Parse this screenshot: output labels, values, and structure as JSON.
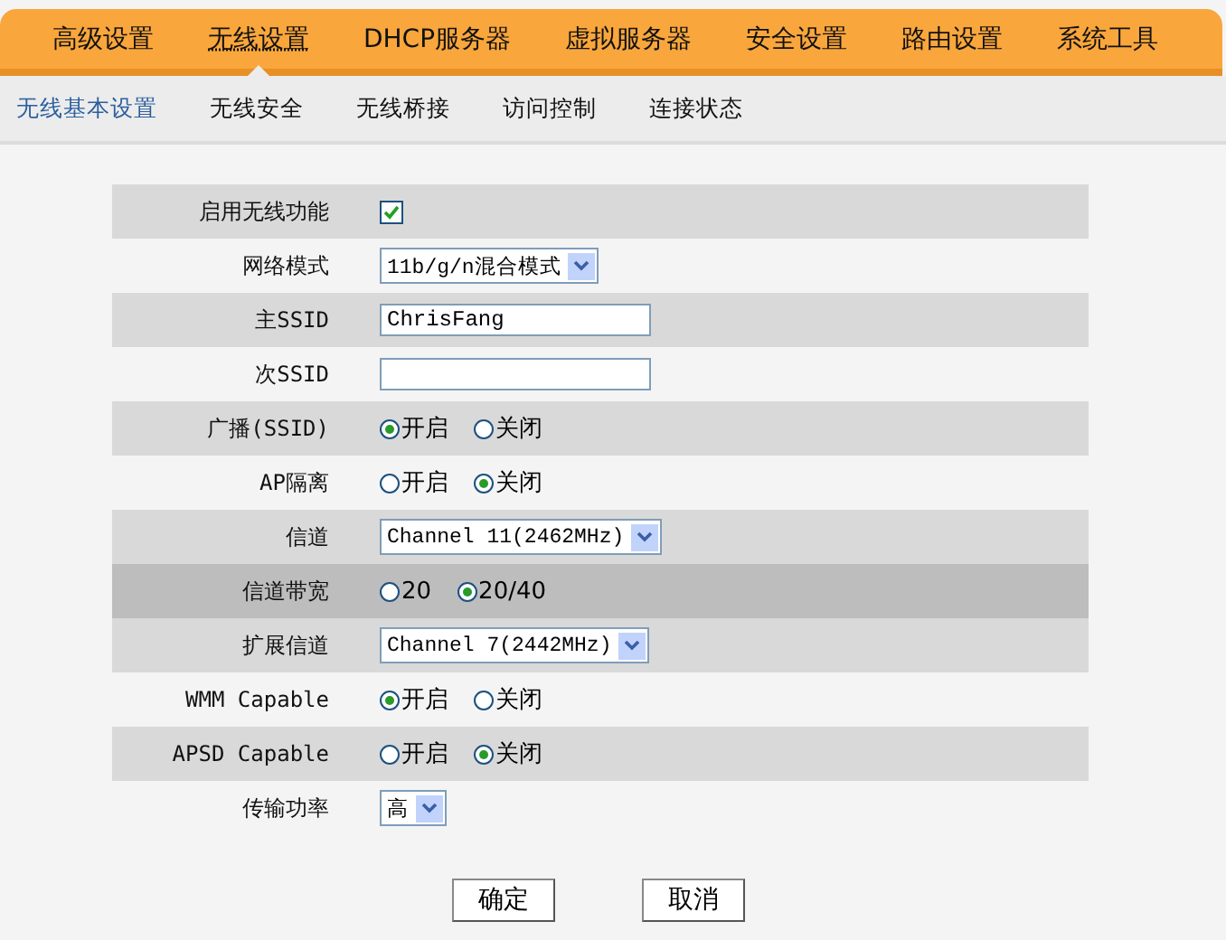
{
  "top_nav": [
    {
      "label": "高级设置",
      "selected": false
    },
    {
      "label": "无线设置",
      "selected": true
    },
    {
      "label": "DHCP服务器",
      "selected": false
    },
    {
      "label": "虚拟服务器",
      "selected": false
    },
    {
      "label": "安全设置",
      "selected": false
    },
    {
      "label": "路由设置",
      "selected": false
    },
    {
      "label": "系统工具",
      "selected": false
    }
  ],
  "sub_nav": [
    {
      "label": "无线基本设置",
      "selected": true
    },
    {
      "label": "无线安全",
      "selected": false
    },
    {
      "label": "无线桥接",
      "selected": false
    },
    {
      "label": "访问控制",
      "selected": false
    },
    {
      "label": "连接状态",
      "selected": false
    }
  ],
  "rows": [
    {
      "label": "启用无线功能",
      "kind": "checkbox",
      "checked": true,
      "highlighted": false
    },
    {
      "label": "网络模式",
      "kind": "select",
      "value": "11b/g/n混合模式",
      "highlighted": false
    },
    {
      "label": "主SSID",
      "kind": "text",
      "value": "ChrisFang",
      "highlighted": false
    },
    {
      "label": "次SSID",
      "kind": "text",
      "highlighted": false
    },
    {
      "label": "广播(SSID)",
      "kind": "radio",
      "highlighted": false,
      "options": [
        {
          "label": "开启",
          "selected": true
        },
        {
          "label": "关闭",
          "selected": false
        }
      ]
    },
    {
      "label": "AP隔离",
      "kind": "radio",
      "highlighted": false,
      "options": [
        {
          "label": "开启",
          "selected": false
        },
        {
          "label": "关闭",
          "selected": true
        }
      ]
    },
    {
      "label": "信道",
      "kind": "select",
      "value": "Channel 11(2462MHz)",
      "highlighted": false
    },
    {
      "label": "信道带宽",
      "kind": "radio",
      "highlighted": true,
      "options": [
        {
          "label": "20",
          "selected": false
        },
        {
          "label": "20/40",
          "selected": true
        }
      ]
    },
    {
      "label": "扩展信道",
      "kind": "select",
      "value": "Channel 7(2442MHz)",
      "highlighted": false
    },
    {
      "label": "WMM Capable",
      "kind": "radio",
      "highlighted": false,
      "options": [
        {
          "label": "开启",
          "selected": true
        },
        {
          "label": "关闭",
          "selected": false
        }
      ]
    },
    {
      "label": "APSD Capable",
      "kind": "radio",
      "highlighted": false,
      "options": [
        {
          "label": "开启",
          "selected": false
        },
        {
          "label": "关闭",
          "selected": true
        }
      ]
    },
    {
      "label": "传输功率",
      "kind": "select",
      "value": "高",
      "highlighted": false
    }
  ],
  "buttons": [
    "确定",
    "取消"
  ]
}
